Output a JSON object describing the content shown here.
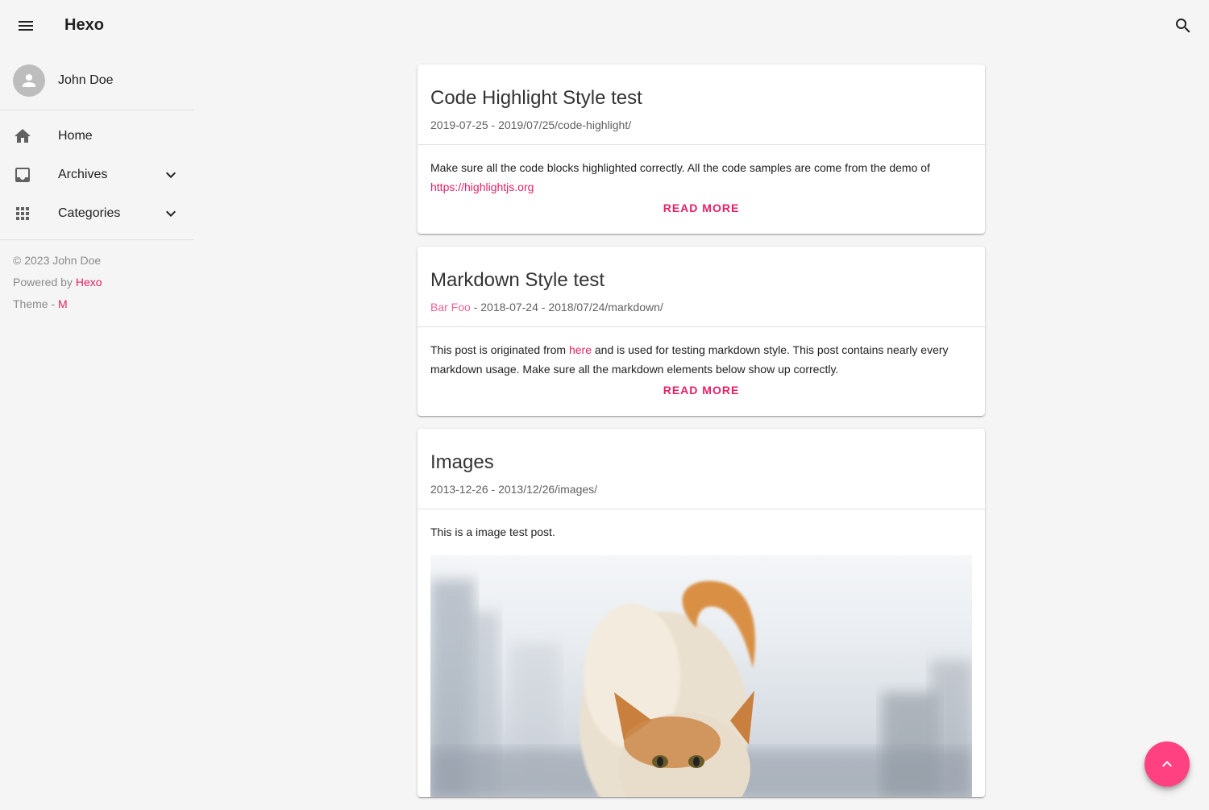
{
  "app": {
    "title": "Hexo"
  },
  "topbar": {
    "menu_icon": "menu-icon",
    "search_icon": "search-icon"
  },
  "sidebar": {
    "user": {
      "name": "John Doe",
      "avatar_icon": "person-icon"
    },
    "items": [
      {
        "label": "Home",
        "icon": "home-icon"
      },
      {
        "label": "Archives",
        "icon": "archive-icon",
        "expandable": true
      },
      {
        "label": "Categories",
        "icon": "apps-icon",
        "expandable": true
      }
    ],
    "footer": {
      "copyright": "© 2023 John Doe",
      "powered_prefix": "Powered by ",
      "powered_link": "Hexo",
      "theme_prefix": "Theme - ",
      "theme_link": "M"
    }
  },
  "posts": [
    {
      "title": "Code Highlight Style test",
      "date": "2019-07-25",
      "path": "2019/07/25/code-highlight/",
      "excerpt": "Make sure all the code blocks highlighted correctly. All the code samples are come from the demo of",
      "excerpt_link": "https://highlightjs.org",
      "read_more": "READ MORE"
    },
    {
      "title": "Markdown Style test",
      "author": "Bar Foo",
      "date": "2018-07-24",
      "path": "2018/07/24/markdown/",
      "excerpt_before": "This post is originated from ",
      "excerpt_link": "here",
      "excerpt_after": " and is used for testing markdown style. This post contains nearly every markdown usage. Make sure all the markdown elements below show up correctly.",
      "read_more": "READ MORE"
    },
    {
      "title": "Images",
      "date": "2013-12-26",
      "path": "2013/12/26/images/",
      "excerpt": "This is a image test post."
    }
  ],
  "fab": {
    "icon": "chevron-up-icon"
  },
  "colors": {
    "accent": "#e91e63",
    "fab": "#ff4081",
    "background": "#f5f5f5"
  }
}
